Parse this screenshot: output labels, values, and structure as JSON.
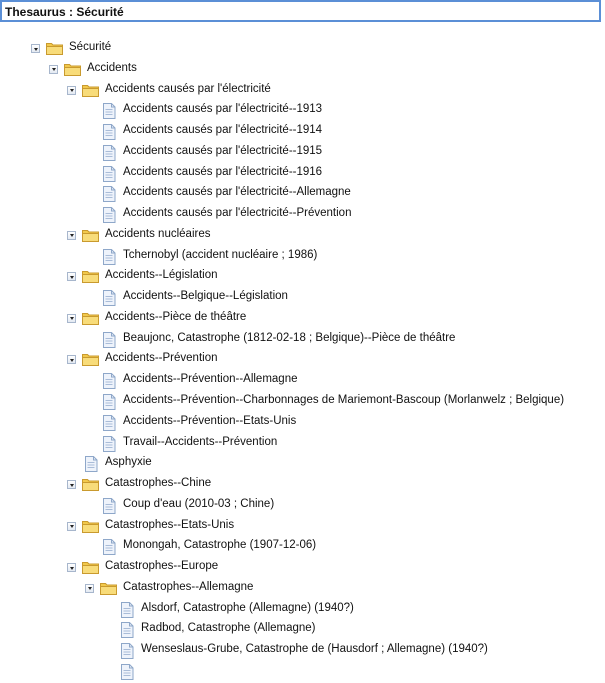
{
  "title": "Thesaurus : Sécurité",
  "tree": [
    {
      "level": 0,
      "type": "folder",
      "label": "Sécurité"
    },
    {
      "level": 1,
      "type": "folder",
      "label": "Accidents"
    },
    {
      "level": 2,
      "type": "folder",
      "label": "Accidents causés par l'électricité"
    },
    {
      "level": 3,
      "type": "doc",
      "label": "Accidents causés par l'électricité--1913"
    },
    {
      "level": 3,
      "type": "doc",
      "label": "Accidents causés par l'électricité--1914"
    },
    {
      "level": 3,
      "type": "doc",
      "label": "Accidents causés par l'électricité--1915"
    },
    {
      "level": 3,
      "type": "doc",
      "label": "Accidents causés par l'électricité--1916"
    },
    {
      "level": 3,
      "type": "doc",
      "label": "Accidents causés par l'électricité--Allemagne"
    },
    {
      "level": 3,
      "type": "doc",
      "label": "Accidents causés par l'électricité--Prévention"
    },
    {
      "level": 2,
      "type": "folder",
      "label": "Accidents nucléaires"
    },
    {
      "level": 3,
      "type": "doc",
      "label": "Tchernobyl (accident nucléaire ; 1986)"
    },
    {
      "level": 2,
      "type": "folder",
      "label": "Accidents--Législation"
    },
    {
      "level": 3,
      "type": "doc",
      "label": "Accidents--Belgique--Législation"
    },
    {
      "level": 2,
      "type": "folder",
      "label": "Accidents--Pièce de théâtre"
    },
    {
      "level": 3,
      "type": "doc",
      "label": "Beaujonc, Catastrophe (1812-02-18 ; Belgique)--Pièce de théâtre"
    },
    {
      "level": 2,
      "type": "folder",
      "label": "Accidents--Prévention"
    },
    {
      "level": 3,
      "type": "doc",
      "label": "Accidents--Prévention--Allemagne"
    },
    {
      "level": 3,
      "type": "doc",
      "label": "Accidents--Prévention--Charbonnages de Mariemont-Bascoup (Morlanwelz ; Belgique)"
    },
    {
      "level": 3,
      "type": "doc",
      "label": "Accidents--Prévention--Etats-Unis"
    },
    {
      "level": 3,
      "type": "doc",
      "label": "Travail--Accidents--Prévention"
    },
    {
      "level": 2,
      "type": "doc",
      "label": "Asphyxie"
    },
    {
      "level": 2,
      "type": "folder",
      "label": "Catastrophes--Chine"
    },
    {
      "level": 3,
      "type": "doc",
      "label": "Coup d'eau (2010-03 ; Chine)"
    },
    {
      "level": 2,
      "type": "folder",
      "label": "Catastrophes--Etats-Unis"
    },
    {
      "level": 3,
      "type": "doc",
      "label": "Monongah, Catastrophe (1907-12-06)"
    },
    {
      "level": 2,
      "type": "folder",
      "label": "Catastrophes--Europe"
    },
    {
      "level": 3,
      "type": "folder",
      "label": "Catastrophes--Allemagne"
    },
    {
      "level": 4,
      "type": "doc",
      "label": "Alsdorf, Catastrophe (Allemagne) (1940?)"
    },
    {
      "level": 4,
      "type": "doc",
      "label": "Radbod, Catastrophe (Allemagne)"
    },
    {
      "level": 4,
      "type": "doc",
      "label": "Wenseslaus-Grube, Catastrophe de (Hausdorf ; Allemagne) (1940?)"
    },
    {
      "level": 4,
      "type": "doc",
      "label": ""
    }
  ]
}
